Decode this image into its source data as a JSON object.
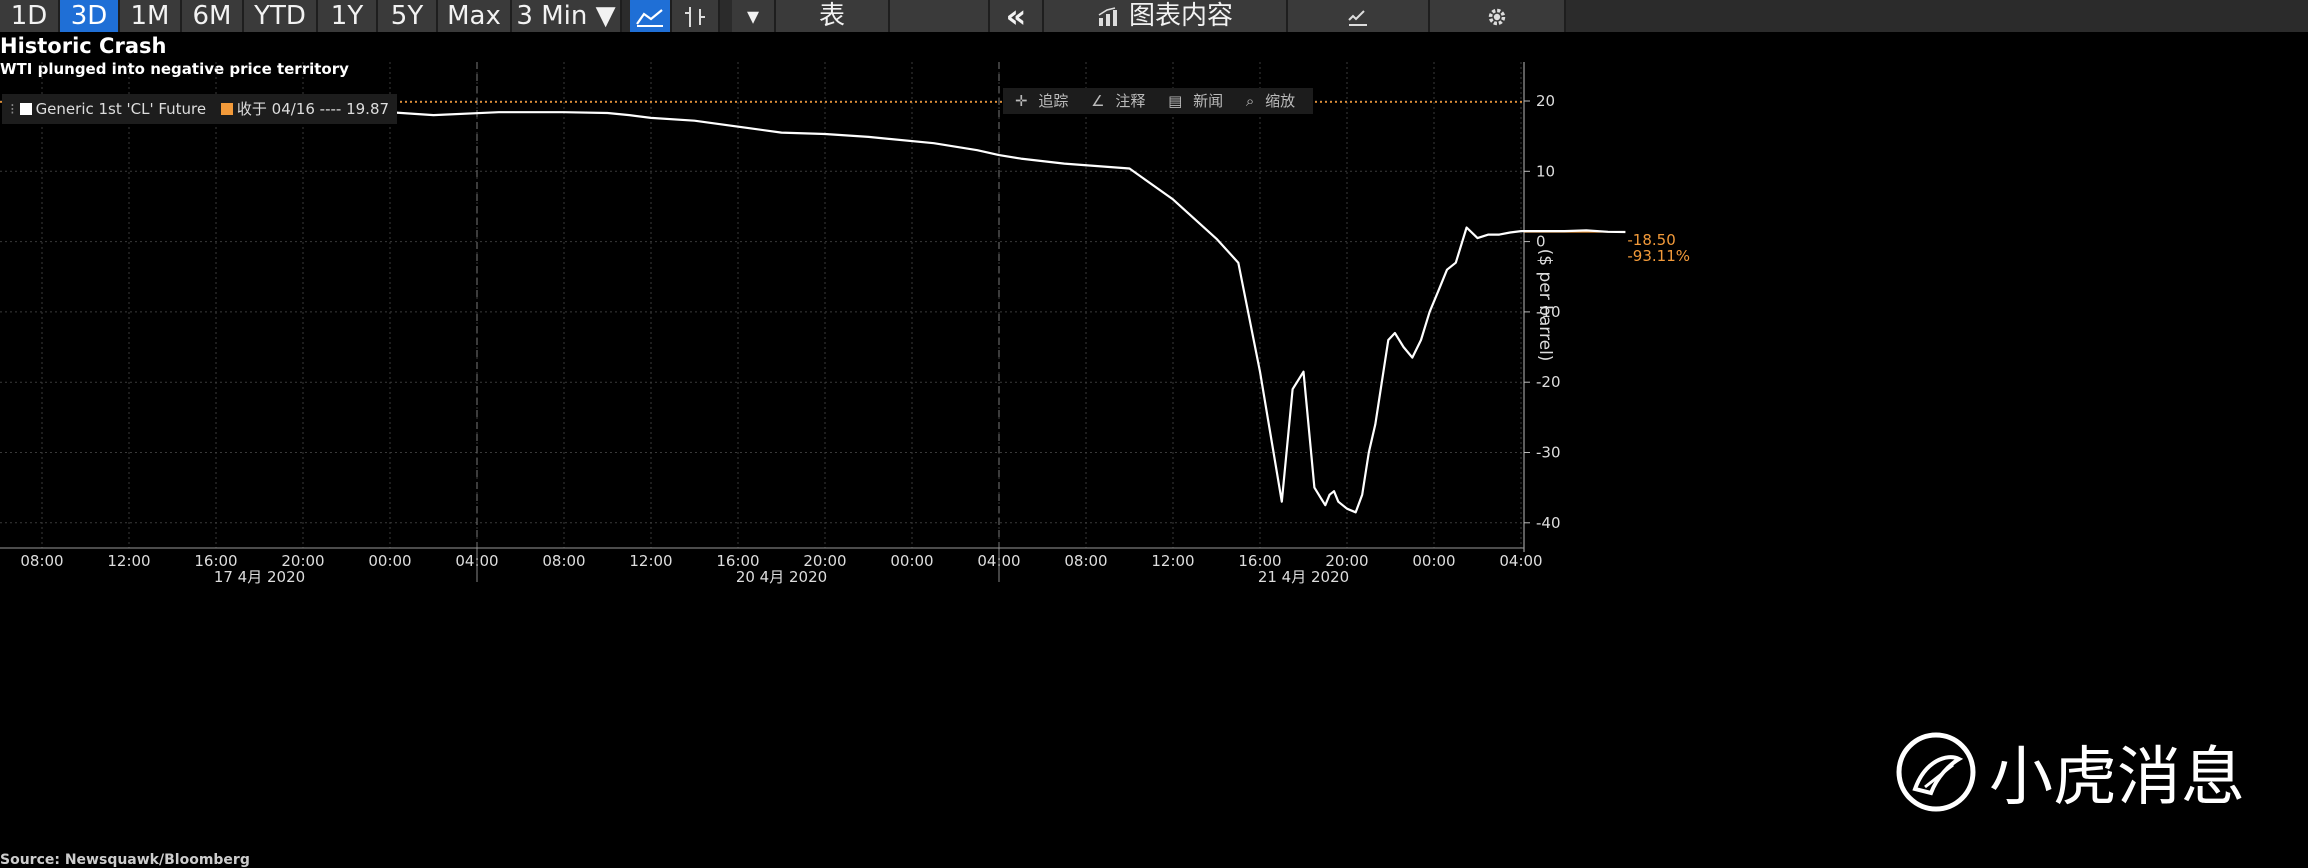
{
  "toolbar": {
    "periods": [
      "1D",
      "3D",
      "1M",
      "6M",
      "YTD",
      "1Y",
      "5Y",
      "Max"
    ],
    "active_period": "3D",
    "interval": "3 Min ▼",
    "table_label": "表",
    "content_label": "图表内容",
    "collapse_glyph": "«",
    "dropdown_glyph": "▾",
    "icons": [
      "line-chart-icon",
      "bar-chart-icon",
      "chevron-down-icon",
      "double-chevron-left-icon",
      "chart-content-icon",
      "edit-icon",
      "gear-icon"
    ]
  },
  "title": "Historic Crash",
  "subtitle": "WTI plunged into negative price territory",
  "legend": {
    "series_label": "Generic 1st 'CL' Future",
    "close_label": "收于 04/16 ---- 19.87",
    "series_color": "#ffffff",
    "close_color": "#f29a3a"
  },
  "tools": [
    "追踪",
    "注释",
    "新闻",
    "缩放"
  ],
  "watermark": "小虎消息",
  "source_text": "Source: Newsquawk/Bloomberg",
  "chart_data": {
    "type": "line",
    "title": "Historic Crash",
    "subtitle": "WTI plunged into negative price territory",
    "ylabel": "($ per barrel)",
    "ylim": [
      -43,
      26
    ],
    "yticks": [
      20,
      10,
      0,
      -10,
      -20,
      -30,
      -40
    ],
    "x_tick_labels": [
      "08:00",
      "12:00",
      "16:00",
      "20:00",
      "00:00",
      "04:00",
      "08:00",
      "12:00",
      "16:00",
      "20:00",
      "00:00",
      "04:00",
      "08:00",
      "12:00",
      "16:00",
      "20:00",
      "00:00",
      "04:00"
    ],
    "x_date_labels": [
      "17 4月 2020",
      "20 4月 2020",
      "21 4月 2020"
    ],
    "grid": true,
    "legend_position": "top-left",
    "reference_line": {
      "label": "收于 04/16",
      "value": 19.87,
      "color": "#f29a3a"
    },
    "last_price_line": {
      "value": 1.37,
      "color": "#f29a3a"
    },
    "annotations": [
      "-18.50",
      "-93.11%"
    ],
    "series": [
      {
        "name": "Generic 1st 'CL' Future",
        "color": "#ffffff",
        "x_hours": [
          0,
          6,
          10,
          11,
          12,
          14,
          18,
          21,
          24,
          26,
          27,
          28,
          30,
          34,
          36,
          38,
          41,
          43,
          44,
          45,
          47,
          50,
          52,
          54,
          55,
          56,
          57,
          57.5,
          58,
          58.5,
          58.8,
          59,
          59.2,
          59.4,
          59.6,
          60,
          60.4,
          60.7,
          61,
          61.3,
          61.6,
          61.9,
          62.2,
          62.6,
          63,
          63.4,
          63.8,
          64.2,
          64.6,
          65,
          65.5,
          66,
          66.5,
          67,
          67.5,
          68,
          69,
          70,
          71,
          72,
          72.8
        ],
        "values": [
          19.9,
          19.7,
          19.3,
          18.4,
          18.4,
          18.8,
          18.0,
          18.4,
          18.4,
          18.3,
          18.0,
          17.6,
          17.2,
          15.5,
          15.3,
          14.9,
          14.0,
          13.0,
          12.3,
          11.8,
          11.1,
          10.4,
          6.0,
          0.4,
          -3.0,
          -18.5,
          -37.0,
          -21.0,
          -18.5,
          -35.0,
          -36.5,
          -37.5,
          -36.0,
          -35.5,
          -37.0,
          -38.0,
          -38.5,
          -36.0,
          -30.0,
          -26.0,
          -20.0,
          -14.0,
          -13.0,
          -15.0,
          -16.5,
          -14.0,
          -10.0,
          -7.0,
          -4.0,
          -3.0,
          2.0,
          0.5,
          1.0,
          1.0,
          1.3,
          1.5,
          1.5,
          1.5,
          1.6,
          1.4,
          1.37
        ]
      }
    ]
  }
}
